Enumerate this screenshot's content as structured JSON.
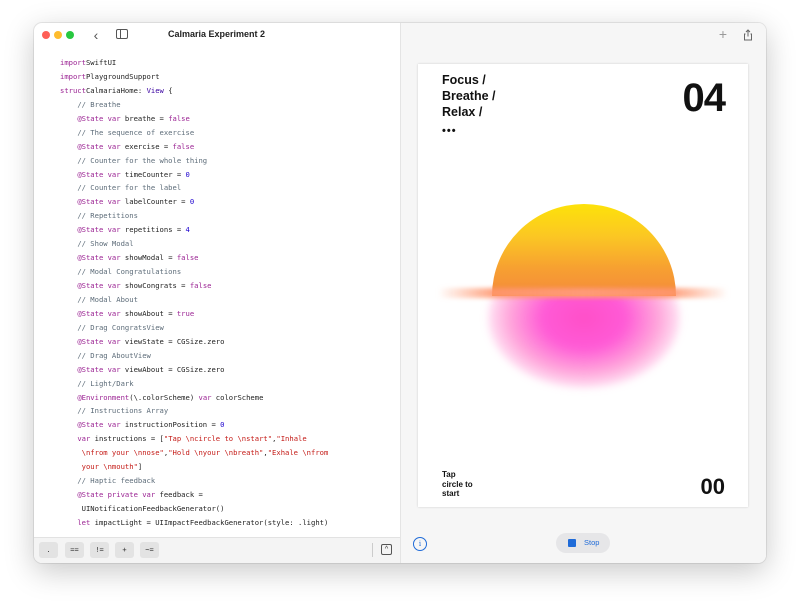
{
  "window": {
    "title": "Calmaria Experiment 2"
  },
  "editor": {
    "lines": [
      [
        [
          "kw",
          "import"
        ],
        [
          "",
          "SwiftUI"
        ]
      ],
      [
        [
          "kw",
          "import"
        ],
        [
          "",
          "PlaygroundSupport"
        ]
      ],
      [
        [
          "kw",
          "struct"
        ],
        [
          "",
          "CalmariaHome: "
        ],
        [
          "ty",
          "View"
        ],
        [
          "",
          " {"
        ]
      ],
      [
        [
          "",
          "    "
        ],
        [
          "cm",
          "// Breathe"
        ]
      ],
      [
        [
          "",
          "    "
        ],
        [
          "kw",
          "@State var"
        ],
        [
          "",
          " breathe = "
        ],
        [
          "kw",
          "false"
        ]
      ],
      [
        [
          "",
          "    "
        ],
        [
          "cm",
          "// The sequence of exercise"
        ]
      ],
      [
        [
          "",
          "    "
        ],
        [
          "kw",
          "@State var"
        ],
        [
          "",
          " exercise = "
        ],
        [
          "kw",
          "false"
        ]
      ],
      [
        [
          "",
          "    "
        ],
        [
          "cm",
          "// Counter for the whole thing"
        ]
      ],
      [
        [
          "",
          "    "
        ],
        [
          "kw",
          "@State var"
        ],
        [
          "",
          " timeCounter = "
        ],
        [
          "num",
          "0"
        ]
      ],
      [
        [
          "",
          "    "
        ],
        [
          "cm",
          "// Counter for the label"
        ]
      ],
      [
        [
          "",
          "    "
        ],
        [
          "kw",
          "@State var"
        ],
        [
          "",
          " labelCounter = "
        ],
        [
          "num",
          "0"
        ]
      ],
      [
        [
          "",
          "    "
        ],
        [
          "cm",
          "// Repetitions"
        ]
      ],
      [
        [
          "",
          "    "
        ],
        [
          "kw",
          "@State var"
        ],
        [
          "",
          " repetitions = "
        ],
        [
          "num",
          "4"
        ]
      ],
      [
        [
          "",
          "    "
        ],
        [
          "cm",
          "// Show Modal"
        ]
      ],
      [
        [
          "",
          "    "
        ],
        [
          "kw",
          "@State var"
        ],
        [
          "",
          " showModal = "
        ],
        [
          "kw",
          "false"
        ]
      ],
      [
        [
          "",
          "    "
        ],
        [
          "cm",
          "// Modal Congratulations"
        ]
      ],
      [
        [
          "",
          "    "
        ],
        [
          "kw",
          "@State var"
        ],
        [
          "",
          " showCongrats = "
        ],
        [
          "kw",
          "false"
        ]
      ],
      [
        [
          "",
          "    "
        ],
        [
          "cm",
          "// Modal About"
        ]
      ],
      [
        [
          "",
          "    "
        ],
        [
          "kw",
          "@State var"
        ],
        [
          "",
          " showAbout = "
        ],
        [
          "kw",
          "true"
        ]
      ],
      [
        [
          "",
          "    "
        ],
        [
          "cm",
          "// Drag CongratsView"
        ]
      ],
      [
        [
          "",
          "    "
        ],
        [
          "kw",
          "@State var"
        ],
        [
          "",
          " viewState = CGSize.zero"
        ]
      ],
      [
        [
          "",
          "    "
        ],
        [
          "cm",
          "// Drag AboutView"
        ]
      ],
      [
        [
          "",
          "    "
        ],
        [
          "kw",
          "@State var"
        ],
        [
          "",
          " viewAbout = CGSize.zero"
        ]
      ],
      [
        [
          "",
          "    "
        ],
        [
          "cm",
          "// Light/Dark"
        ]
      ],
      [
        [
          "",
          "    "
        ],
        [
          "kw",
          "@Environment"
        ],
        [
          "",
          "(\\.colorScheme) "
        ],
        [
          "kw",
          "var"
        ],
        [
          "",
          " colorScheme"
        ]
      ],
      [
        [
          "",
          "    "
        ],
        [
          "cm",
          "// Instructions Array"
        ]
      ],
      [
        [
          "",
          "    "
        ],
        [
          "kw",
          "@State var"
        ],
        [
          "",
          " instructionPosition = "
        ],
        [
          "num",
          "0"
        ]
      ],
      [
        [
          "",
          "    "
        ],
        [
          "kw",
          "var"
        ],
        [
          "",
          " instructions = ["
        ],
        [
          "str",
          "\"Tap \\ncircle to \\nstart\""
        ],
        [
          "",
          ","
        ],
        [
          "str",
          "\"Inhale"
        ]
      ],
      [
        [
          "",
          "     "
        ],
        [
          "str",
          "\\nfrom your \\nnose\""
        ],
        [
          "",
          ","
        ],
        [
          "str",
          "\"Hold \\nyour \\nbreath\""
        ],
        [
          "",
          ","
        ],
        [
          "str",
          "\"Exhale \\nfrom"
        ]
      ],
      [
        [
          "",
          "     "
        ],
        [
          "str",
          "your \\nmouth\""
        ],
        [
          "",
          "]"
        ]
      ],
      [
        [
          "",
          "    "
        ],
        [
          "cm",
          "// Haptic feedback"
        ]
      ],
      [
        [
          "",
          "    "
        ],
        [
          "kw",
          "@State private var"
        ],
        [
          "",
          " feedback ="
        ]
      ],
      [
        [
          "",
          "     UINotificationFeedbackGenerator()"
        ]
      ],
      [
        [
          "",
          "    "
        ],
        [
          "kw",
          "let"
        ],
        [
          "",
          " impactLight = UIImpactFeedbackGenerator(style: .light)"
        ]
      ]
    ]
  },
  "toolbar": {
    "keys": [
      ".",
      "==",
      "!=",
      "+",
      "~="
    ],
    "collapse_icon": "chevron-up-icon"
  },
  "preview": {
    "heading_lines": [
      "Focus /",
      "Breathe /",
      "Relax /"
    ],
    "dots": "•••",
    "big_counter": "04",
    "instruction_lines": [
      "Tap",
      "circle to",
      "start"
    ],
    "small_counter": "00",
    "stop_label": "Stop",
    "colors": {
      "accent": "#1f6bd8",
      "sun_top": "#fde20a",
      "sun_mid": "#f48a3b",
      "sun_bottom": "#ff4fc8"
    }
  },
  "icons": {
    "back": "chevron-left-icon",
    "sidebar": "sidebar-toggle-icon",
    "add": "plus-icon",
    "share": "share-icon",
    "info": "info-icon",
    "stop": "stop-icon"
  }
}
